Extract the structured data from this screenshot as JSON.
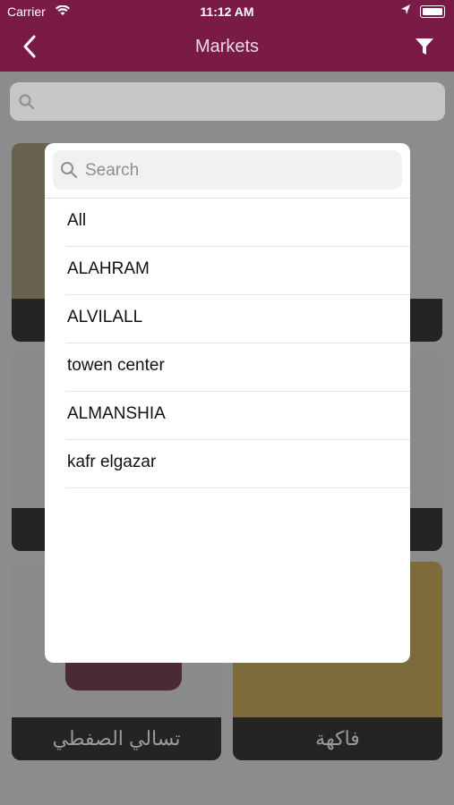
{
  "status_bar": {
    "carrier": "Carrier",
    "time": "11:12 AM"
  },
  "navbar": {
    "title": "Markets"
  },
  "search": {
    "placeholder": ""
  },
  "cards": [
    {
      "caption": ""
    },
    {
      "caption": ""
    },
    {
      "caption": ""
    },
    {
      "caption": ""
    },
    {
      "caption": "تسالي الصفطي"
    },
    {
      "caption": "فاكهة"
    }
  ],
  "picker": {
    "search_placeholder": "Search",
    "items": [
      "All",
      "ALAHRAM",
      "ALVILALL",
      "towen center",
      "ALMANSHIA",
      "kafr elgazar"
    ]
  },
  "colors": {
    "brand": "#7a1b47"
  },
  "icons": [
    "wifi-icon",
    "location-icon",
    "battery-icon",
    "back-chevron-icon",
    "filter-icon",
    "search-icon"
  ]
}
